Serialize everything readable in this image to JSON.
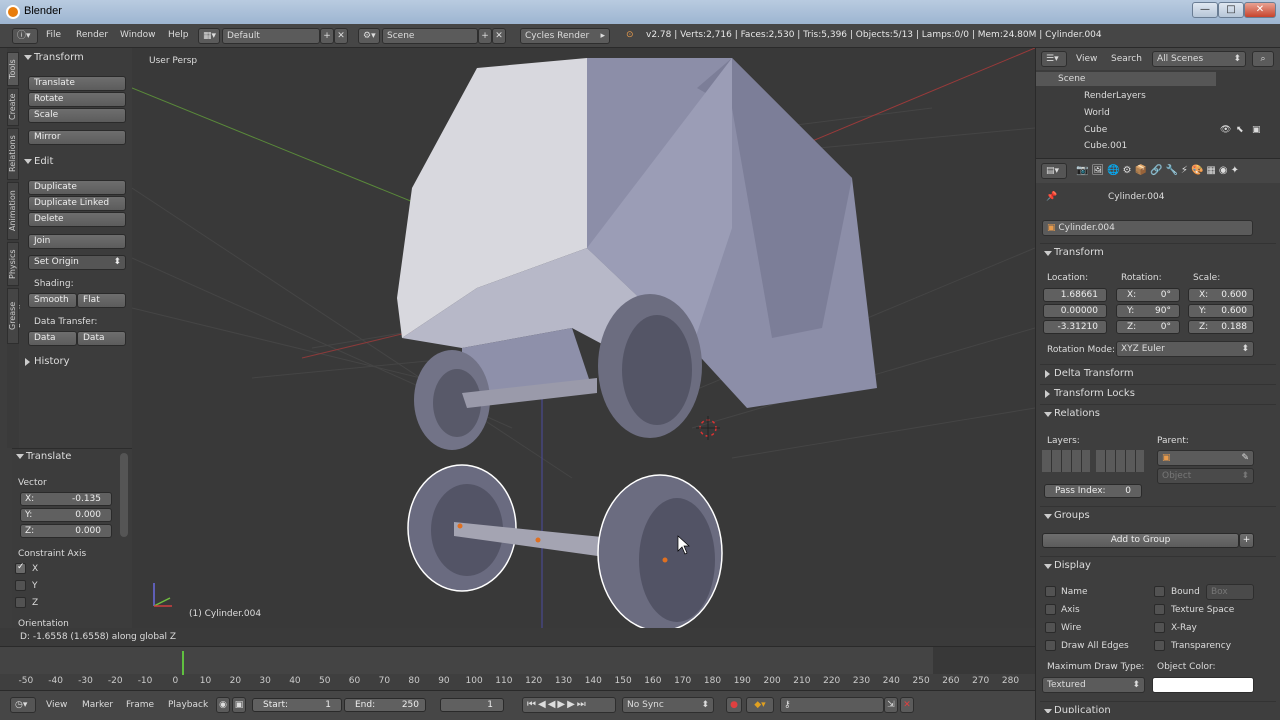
{
  "window": {
    "title": "Blender",
    "min": "—",
    "max": "□",
    "close": "✕"
  },
  "menu": {
    "file": "File",
    "render": "Render",
    "window": "Window",
    "help": "Help",
    "layout": "Default",
    "scene": "Scene",
    "engine": "Cycles Render",
    "stats": "v2.78 | Verts:2,716 | Faces:2,530 | Tris:5,396 | Objects:5/13 | Lamps:0/0 | Mem:24.80M | Cylinder.004"
  },
  "toolshelf": {
    "tabs": [
      "Tools",
      "Create",
      "Relations",
      "Animation",
      "Physics",
      "Grease Pencil"
    ],
    "transform_header": "Transform",
    "translate": "Translate",
    "rotate": "Rotate",
    "scale": "Scale",
    "mirror": "Mirror",
    "edit_header": "Edit",
    "duplicate": "Duplicate",
    "duplicate_linked": "Duplicate Linked",
    "delete": "Delete",
    "join": "Join",
    "set_origin": "Set Origin",
    "shading_label": "Shading:",
    "smooth": "Smooth",
    "flat": "Flat",
    "data_transfer_label": "Data Transfer:",
    "data": "Data",
    "data_layout": "Data Layo",
    "history_header": "History"
  },
  "operator": {
    "header": "Translate",
    "vector_label": "Vector",
    "x_label": "X:",
    "x_value": "-0.135",
    "y_label": "Y:",
    "y_value": "0.000",
    "z_label": "Z:",
    "z_value": "0.000",
    "constraint_label": "Constraint Axis",
    "cx": "X",
    "cy": "Y",
    "cz": "Z",
    "orientation_label": "Orientation"
  },
  "viewport": {
    "view_name": "User Persp",
    "object_name": "(1) Cylinder.004"
  },
  "status": {
    "text": "D: -1.6558 (1.6558) along global Z"
  },
  "timeline": {
    "ticks": [
      "-50",
      "-40",
      "-30",
      "-20",
      "-10",
      "0",
      "10",
      "20",
      "30",
      "40",
      "50",
      "60",
      "70",
      "80",
      "90",
      "100",
      "110",
      "120",
      "130",
      "140",
      "150",
      "160",
      "170",
      "180",
      "190",
      "200",
      "210",
      "220",
      "230",
      "240",
      "250",
      "260",
      "270",
      "280"
    ],
    "view": "View",
    "marker": "Marker",
    "frame": "Frame",
    "playback": "Playback",
    "start_label": "Start:",
    "start_value": "1",
    "end_label": "End:",
    "end_value": "250",
    "current": "1",
    "sync": "No Sync"
  },
  "outliner": {
    "view": "View",
    "search": "Search",
    "filter": "All Scenes",
    "items": [
      "Scene",
      "RenderLayers",
      "World",
      "Cube",
      "Cube.001"
    ]
  },
  "properties": {
    "object_name": "Cylinder.004",
    "name_field": "Cylinder.004",
    "transform_header": "Transform",
    "location_label": "Location:",
    "rotation_label": "Rotation:",
    "scale_label": "Scale:",
    "loc_x": "1.68661",
    "loc_y": "0.00000",
    "loc_z": "-3.31210",
    "rot_x_label": "X:",
    "rot_x": "0°",
    "rot_y_label": "Y:",
    "rot_y": "90°",
    "rot_z_label": "Z:",
    "rot_z": "0°",
    "scale_x_label": "X:",
    "scale_x": "0.600",
    "scale_y_label": "Y:",
    "scale_y": "0.600",
    "scale_z_label": "Z:",
    "scale_z": "0.188",
    "rotation_mode_label": "Rotation Mode:",
    "rotation_mode": "XYZ Euler",
    "delta_transform": "Delta Transform",
    "transform_locks": "Transform Locks",
    "relations": "Relations",
    "layers_label": "Layers:",
    "parent_label": "Parent:",
    "parent_type": "Object",
    "pass_index_label": "Pass Index:",
    "pass_index": "0",
    "groups": "Groups",
    "add_to_group": "Add to Group",
    "display": "Display",
    "name_opt": "Name",
    "bound_opt": "Bound",
    "bound_type": "Box",
    "axis_opt": "Axis",
    "texture_space_opt": "Texture Space",
    "wire_opt": "Wire",
    "xray_opt": "X-Ray",
    "draw_all_edges_opt": "Draw All Edges",
    "transparency_opt": "Transparency",
    "max_draw_type_label": "Maximum Draw Type:",
    "object_color_label": "Object Color:",
    "max_draw_type": "Textured",
    "duplication": "Duplication"
  }
}
